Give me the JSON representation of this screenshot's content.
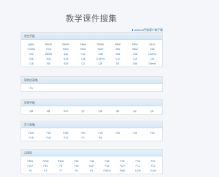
{
  "header": {
    "title": "教学课件搜集",
    "download_label": "Android平板客户端下载"
  },
  "sections": [
    {
      "title": "学生平板",
      "items": [
        "Q800",
        "S5000",
        "S5600",
        "S666",
        "S5000",
        "S888",
        "S300",
        "S100",
        "G1554",
        "F100",
        "S509",
        "S500",
        "Z999",
        "S56",
        "S600",
        "S56",
        "S90",
        "S5000",
        "S35",
        "F32",
        "C36",
        "S38",
        "C26",
        "C20Pro",
        "S26",
        "S35",
        "G15",
        "C26",
        "C10Pro",
        "C12",
        "C12",
        "C11",
        "C16",
        "S6",
        "S16",
        "C5",
        "Q5",
        "E5",
        "D26",
        "Greenl"
      ]
    },
    {
      "title": "导航仿读笔",
      "items": [
        "G1"
      ]
    },
    {
      "title": "学练平板",
      "items": [
        "Q8",
        "Q8",
        "G70",
        "Q7",
        "Q6",
        "Q5",
        "Q2",
        "Q1"
      ]
    },
    {
      "title": "学习电脑",
      "items": [
        "F100",
        "F50",
        "F300",
        "F50",
        "F20",
        "F25",
        "F32",
        "F33",
        "F15",
        "F16",
        "F12",
        "F2",
        "F8"
      ]
    },
    {
      "title": "点读机",
      "items": [
        "F800",
        "F200",
        "F100",
        "F60",
        "F36",
        "F38",
        "F30",
        "F28",
        "F20",
        "F16+",
        "F10",
        "F8",
        "F16",
        "F16+",
        "F16",
        "F12+",
        "F11",
        "F10",
        "F9",
        "F8",
        "F7",
        "F6",
        "F3",
        "F3000",
        "F600",
        "E200",
        "E100"
      ]
    }
  ]
}
